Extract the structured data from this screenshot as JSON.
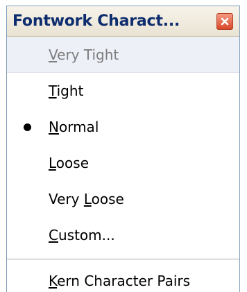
{
  "window": {
    "title": "Fontwork Charact..."
  },
  "menu": {
    "items": [
      {
        "accel": "V",
        "rest": "ery Tight",
        "pre": "",
        "enabled": false,
        "checked": false
      },
      {
        "accel": "T",
        "rest": "ight",
        "pre": "",
        "enabled": true,
        "checked": false
      },
      {
        "accel": "N",
        "rest": "ormal",
        "pre": "",
        "enabled": true,
        "checked": true
      },
      {
        "accel": "L",
        "rest": "oose",
        "pre": "",
        "enabled": true,
        "checked": false
      },
      {
        "pre": "Very ",
        "accel": "L",
        "rest": "oose",
        "enabled": true,
        "checked": false
      },
      {
        "accel": "C",
        "rest": "ustom...",
        "pre": "",
        "enabled": true,
        "checked": false
      }
    ],
    "footer_item": {
      "accel": "K",
      "rest": "ern Character Pairs"
    }
  },
  "colors": {
    "title_text": "#0d2d6e",
    "close_button": "#d8482a",
    "disabled_text": "#7d7d7d"
  },
  "icons": {
    "close": "close-icon",
    "checked": "bullet-icon"
  }
}
